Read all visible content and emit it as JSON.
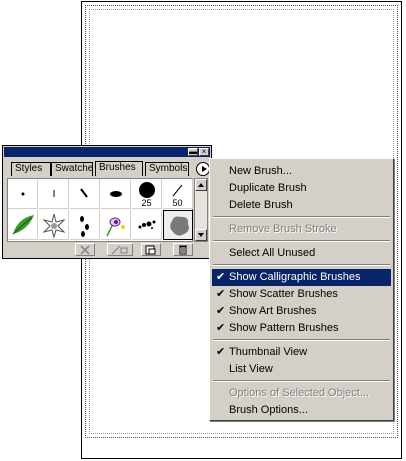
{
  "palette": {
    "tabs": [
      "Styles",
      "Swatches",
      "Brushes",
      "Symbols"
    ],
    "active_tab": "Brushes",
    "brush_labels": {
      "size_25": "25",
      "size_50": "50"
    }
  },
  "menu": {
    "items": [
      {
        "label": "New Brush...",
        "enabled": true,
        "checked": false
      },
      {
        "label": "Duplicate Brush",
        "enabled": true,
        "checked": false
      },
      {
        "label": "Delete Brush",
        "enabled": true,
        "checked": false
      },
      {
        "label": "Remove Brush Stroke",
        "enabled": false,
        "checked": false
      },
      {
        "label": "Select All Unused",
        "enabled": true,
        "checked": false
      },
      {
        "label": "Show Calligraphic Brushes",
        "enabled": true,
        "checked": true,
        "highlighted": true
      },
      {
        "label": "Show Scatter Brushes",
        "enabled": true,
        "checked": true
      },
      {
        "label": "Show Art Brushes",
        "enabled": true,
        "checked": true
      },
      {
        "label": "Show Pattern Brushes",
        "enabled": true,
        "checked": true
      },
      {
        "label": "Thumbnail View",
        "enabled": true,
        "checked": true
      },
      {
        "label": "List View",
        "enabled": true,
        "checked": false
      },
      {
        "label": "Options of Selected Object...",
        "enabled": false,
        "checked": false
      },
      {
        "label": "Brush Options...",
        "enabled": true,
        "checked": false
      }
    ],
    "checkmark": "✔"
  },
  "colors": {
    "highlight": "#0a246a",
    "face": "#d4d0c8"
  }
}
